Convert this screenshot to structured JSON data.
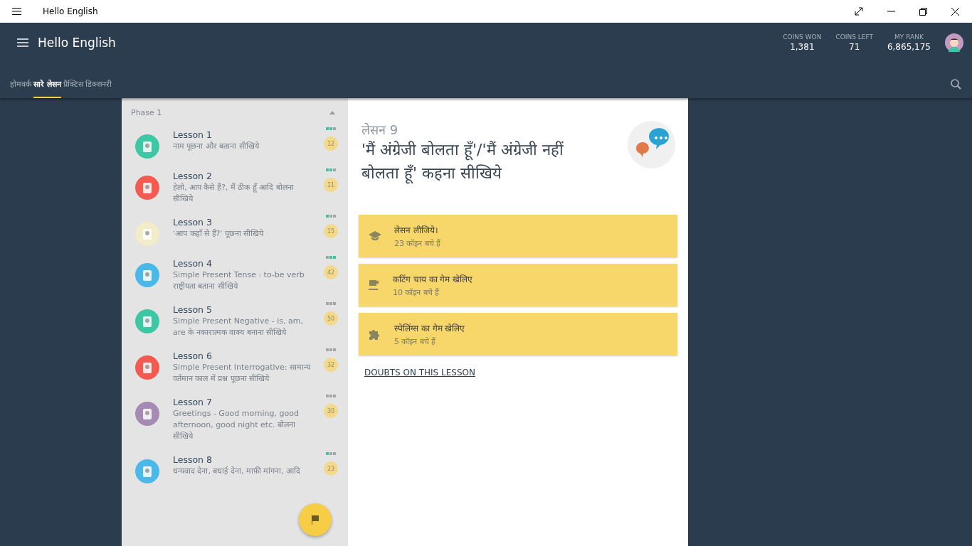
{
  "window": {
    "title": "Hello English"
  },
  "header": {
    "title": "Hello English",
    "stats": [
      {
        "label": "COINS WON",
        "value": "1,381"
      },
      {
        "label": "COINS LEFT",
        "value": "71"
      },
      {
        "label": "MY RANK",
        "value": "6,865,175"
      }
    ]
  },
  "tabs": [
    {
      "label": "होमवर्क",
      "selected": false
    },
    {
      "label": "सारे लेसन",
      "selected": true
    },
    {
      "label": "प्रैक्टिस",
      "selected": false
    },
    {
      "label": "डिक्शनरी",
      "selected": false
    }
  ],
  "phase": {
    "title": "Phase 1",
    "expanded": true
  },
  "lessons": [
    {
      "title": "Lesson 1",
      "description": "नाम पूछना और बताना सीखिये",
      "count": "12",
      "color": "#3dc7a4",
      "progress": [
        true,
        true,
        false
      ]
    },
    {
      "title": "Lesson 2",
      "description": "हेलो, आप कैसे हैं?, मैं ठीक हूँ आदि बोलना सीखिये",
      "count": "11",
      "color": "#f35b52",
      "progress": [
        true,
        true,
        false
      ]
    },
    {
      "title": "Lesson 3",
      "description": "'आप कहाँ से हैं?' पूछना सीखिये",
      "count": "15",
      "color": "#f3ecc8",
      "progress": [
        true,
        false,
        false
      ]
    },
    {
      "title": "Lesson 4",
      "description": "Simple Present Tense : to-be verb राष्ट्रीयता बताना सीखिये",
      "count": "42",
      "color": "#4ab8e8",
      "progress": [
        false,
        true,
        true
      ]
    },
    {
      "title": "Lesson 5",
      "description": "Simple Present Negative - is, am, are के नकारात्मक वाक्य बनाना सीखिये",
      "count": "50",
      "color": "#3dc7a4",
      "progress": [
        false,
        false,
        false
      ]
    },
    {
      "title": "Lesson 6",
      "description": "Simple Present Interrogative: सामान्य वर्तमान काल में प्रश्न पूछना सीखिये",
      "count": "32",
      "color": "#f35b52",
      "progress": [
        false,
        false,
        false
      ]
    },
    {
      "title": "Lesson 7",
      "description": "Greetings - Good morning, good afternoon, good night etc. बोलना सीखिये",
      "count": "30",
      "color": "#a58bb3",
      "progress": [
        false,
        false,
        false
      ]
    },
    {
      "title": "Lesson 8",
      "description": "धन्यवाद देना, बधाई देना, माफ़ी मांगना, आदि",
      "count": "23",
      "color": "#4ab8e8",
      "progress": [
        true,
        false,
        false
      ]
    }
  ],
  "detail": {
    "subtitle": "लेसन 9",
    "title": "'मैं अंग्रेजी बोलता हूँ'/'मैं अंग्रेजी नहीं बोलता हूँ' कहना सीखिये",
    "actions": [
      {
        "kind": "lesson",
        "title": "लेसन लीजिये।",
        "coins": "23 कॉइन बचे हैं"
      },
      {
        "kind": "tea",
        "title": "कटिंग चाय का गेम खेलिए",
        "coins": "10 कॉइन बचे हैं"
      },
      {
        "kind": "puzzle",
        "title": "स्पेलिंग्स का गेम खेलिए",
        "coins": "5 कॉइन बचे हैं"
      }
    ],
    "link": "DOUBTS ON THIS LESSON"
  }
}
